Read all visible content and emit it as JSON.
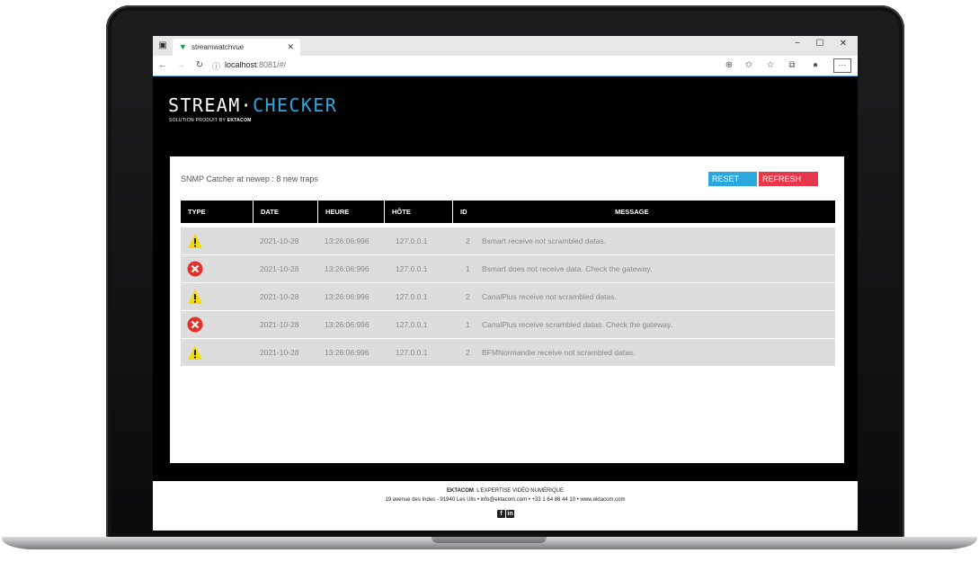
{
  "browser": {
    "tab_title": "streamwatchvue",
    "url_host": "localhost",
    "url_rest": ":8081/#/"
  },
  "app": {
    "logo_main": "STREAM·",
    "logo_accent": "CHECKER",
    "logo_sub": "SOLUTION PRODUIT BY ",
    "logo_sub_brand": "EKTACOM"
  },
  "panel": {
    "title": "SNMP Catcher at newep : 8 new traps",
    "reset_label": "RESET",
    "refresh_label": "REFRESH",
    "columns": [
      "TYPE",
      "DATE",
      "HEURE",
      "HÔTE",
      "ID",
      "MESSAGE"
    ],
    "rows": [
      {
        "type": "warning",
        "date": "2021-10-28",
        "time": "13:26:06:996",
        "host": "127.0.0.1",
        "id": "2",
        "message": "Bsmart receive not scrambled datas."
      },
      {
        "type": "error",
        "date": "2021-10-28",
        "time": "13:26:06:996",
        "host": "127.0.0.1",
        "id": "1",
        "message": "Bsmart does not receive data. Check the gateway."
      },
      {
        "type": "warning",
        "date": "2021-10-28",
        "time": "13:26:06:996",
        "host": "127.0.0.1",
        "id": "2",
        "message": "CanalPlus receive not scrambled datas."
      },
      {
        "type": "error",
        "date": "2021-10-28",
        "time": "13:26:06:996",
        "host": "127.0.0.1",
        "id": "1",
        "message": "CanalPlus receive scrambled datas. Check the gateway."
      },
      {
        "type": "warning",
        "date": "2021-10-28",
        "time": "13:26:06:996",
        "host": "127.0.0.1",
        "id": "2",
        "message": "BFMNormandie receive not scrambled datas."
      }
    ]
  },
  "footer": {
    "brand": "EKTACOM",
    "tagline": "L'EXPERTISE VIDÉO NUMÉRIQUE",
    "address": "19 avenue des Indes - 91940 Les Ulis • info@ektacom.com • +33 1 64 86 44 10 • www.ektacom.com"
  },
  "colors": {
    "accent_blue": "#2aa7de",
    "refresh_red": "#e8374a",
    "warning_yellow": "#f5d90a",
    "error_red": "#e4322b"
  }
}
